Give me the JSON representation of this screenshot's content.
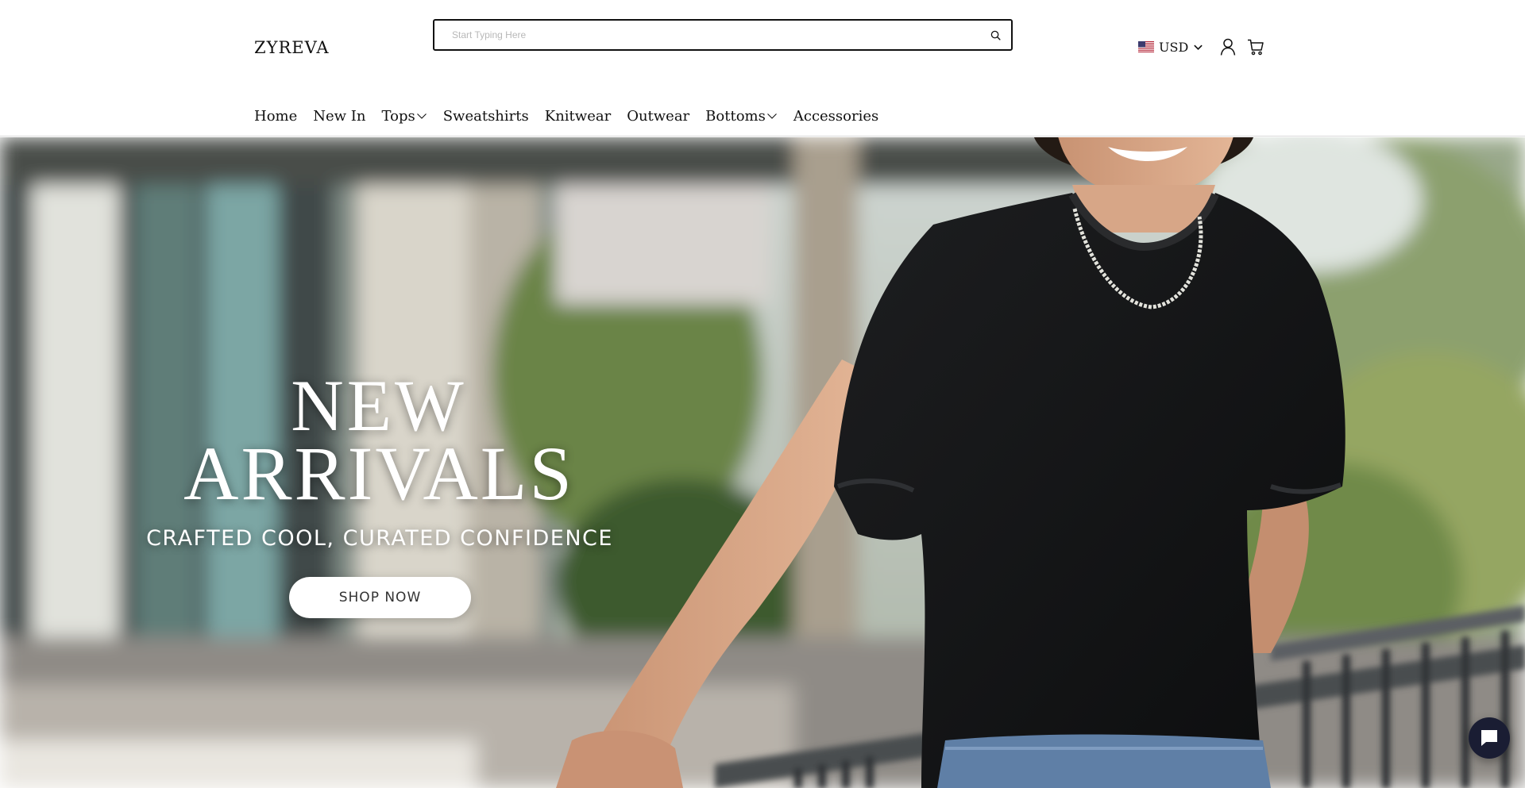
{
  "header": {
    "logo": "ZYREVA",
    "search": {
      "placeholder": "Start Typing Here",
      "value": ""
    },
    "currency": {
      "label": "USD",
      "flag_icon": "us-flag-icon"
    }
  },
  "nav": {
    "items": [
      {
        "label": "Home",
        "has_dropdown": false
      },
      {
        "label": "New In",
        "has_dropdown": false
      },
      {
        "label": "Tops",
        "has_dropdown": true
      },
      {
        "label": "Sweatshirts",
        "has_dropdown": false
      },
      {
        "label": "Knitwear",
        "has_dropdown": false
      },
      {
        "label": "Outwear",
        "has_dropdown": false
      },
      {
        "label": "Bottoms",
        "has_dropdown": true
      },
      {
        "label": "Accessories",
        "has_dropdown": false
      }
    ]
  },
  "hero": {
    "title_line1": "NEW",
    "title_line2": "ARRIVALS",
    "subtitle": "CRAFTED COOL, CURATED CONFIDENCE",
    "cta_label": "SHOP NOW"
  },
  "colors": {
    "text": "#111111",
    "chat_button": "#1a1d33",
    "hero_text": "#ffffff"
  }
}
